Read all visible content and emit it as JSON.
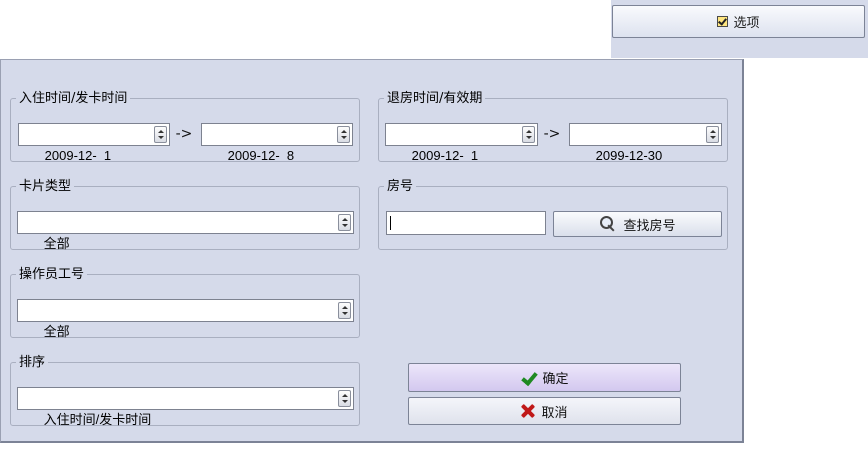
{
  "options": {
    "label": "选项"
  },
  "checkin": {
    "legend": "入住时间/发卡时间",
    "from": "2009-12-  1",
    "arrow": "->",
    "to": "2009-12-  8"
  },
  "checkout": {
    "legend": "退房时间/有效期",
    "from": "2009-12-  1",
    "arrow": "->",
    "to": "2099-12-30"
  },
  "card_type": {
    "legend": "卡片类型",
    "value": "全部"
  },
  "room": {
    "legend": "房号",
    "value": "",
    "search_label": "查找房号"
  },
  "operator": {
    "legend": "操作员工号",
    "value": "全部"
  },
  "sort": {
    "legend": "排序",
    "value": "入住时间/发卡时间"
  },
  "actions": {
    "ok_label": "确定",
    "cancel_label": "取消"
  }
}
